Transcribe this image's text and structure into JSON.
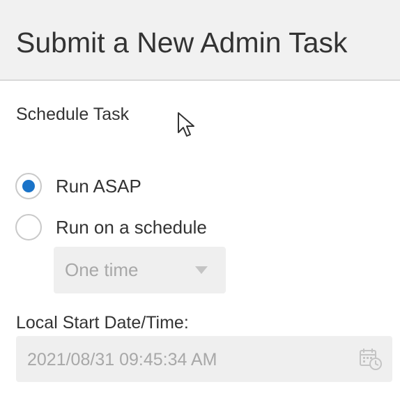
{
  "header": {
    "title": "Submit a New Admin Task"
  },
  "schedule": {
    "section_label": "Schedule Task",
    "options": [
      {
        "label": "Run ASAP",
        "checked": true
      },
      {
        "label": "Run on a schedule",
        "checked": false
      }
    ],
    "frequency": {
      "selected": "One time",
      "disabled": true
    }
  },
  "start_time": {
    "label": "Local Start Date/Time:",
    "value": "2021/08/31 09:45:34 AM",
    "disabled": true
  },
  "icons": {
    "calendar": "calendar-clock-icon",
    "cursor": "mouse-pointer-icon",
    "caret": "caret-down-icon"
  },
  "colors": {
    "accent": "#1a73c8",
    "header_bg": "#f1f1f1",
    "disabled_bg": "#efefef",
    "disabled_text": "#a8a8a8"
  }
}
